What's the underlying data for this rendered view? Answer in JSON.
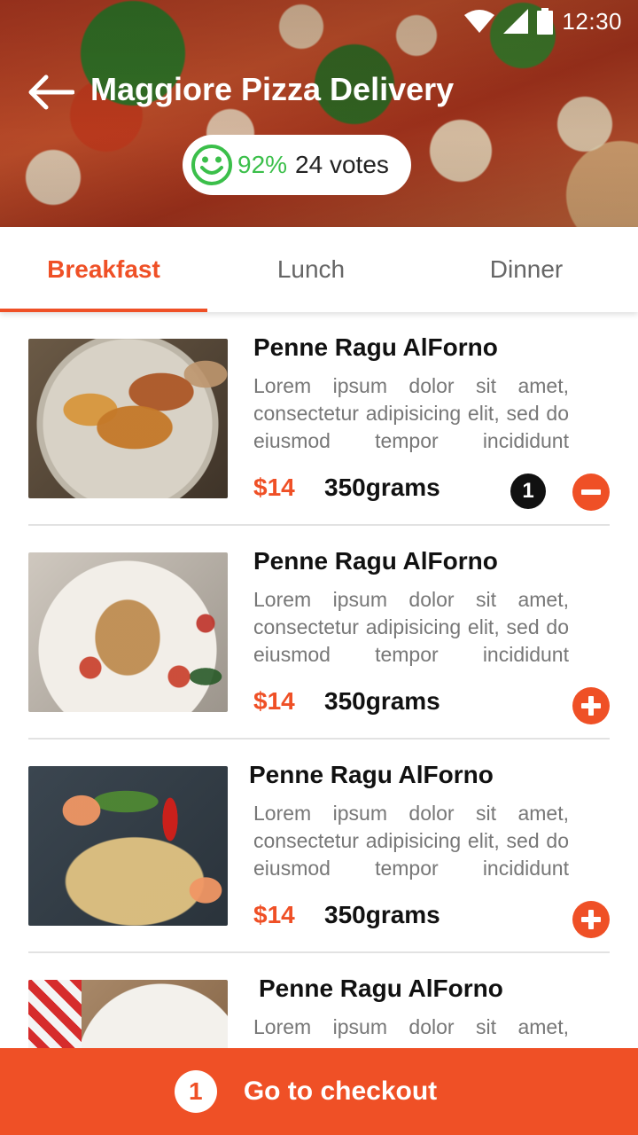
{
  "status_bar": {
    "time": "12:30"
  },
  "header": {
    "title": "Maggiore Pizza Delivery"
  },
  "rating": {
    "percent": "92%",
    "votes": "24 votes"
  },
  "tabs": [
    {
      "label": "Breakfast",
      "active": true
    },
    {
      "label": "Lunch",
      "active": false
    },
    {
      "label": "Dinner",
      "active": false
    }
  ],
  "items": [
    {
      "name": "Penne Ragu AlForno",
      "description": "Lorem ipsum dolor sit amet, consectetur adipisicing elit, sed do eiusmod tempor incididunt",
      "price": "$14",
      "weight": "350grams",
      "quantity": "1",
      "action": "remove"
    },
    {
      "name": "Penne Ragu AlForno",
      "description": "Lorem ipsum dolor sit amet, consectetur adipisicing elit, sed do eiusmod tempor incididunt",
      "price": "$14",
      "weight": "350grams",
      "action": "add"
    },
    {
      "name": "Penne Ragu AlForno",
      "description": "Lorem ipsum dolor sit amet, consectetur adipisicing elit, sed do eiusmod tempor incididunt",
      "price": "$14",
      "weight": "350grams",
      "action": "add"
    },
    {
      "name": "Penne Ragu AlForno",
      "description": "Lorem ipsum dolor sit amet,"
    }
  ],
  "checkout": {
    "count": "1",
    "label": "Go to checkout"
  },
  "colors": {
    "accent": "#ef5026",
    "rating_green": "#3bbf4a"
  }
}
